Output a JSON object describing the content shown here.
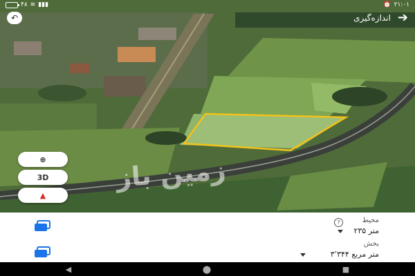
{
  "status_bar": {
    "time": "۲۱:۰۱",
    "battery": "۴۸"
  },
  "header": {
    "title": "اندازه‌گیری"
  },
  "map_controls": {
    "view_3d_label": "3D"
  },
  "watermark": "زمین باز",
  "measurement": {
    "perimeter": {
      "label": "محیط",
      "value": "۲۳۵ متر"
    },
    "area": {
      "label": "بخش",
      "value": "۳٬۳۴۴ متر مربع"
    }
  },
  "colors": {
    "outline": "#f3c21b",
    "sheet": "#ffffff",
    "copy_icon": "#1a73e8"
  },
  "icons": {
    "back": "arrow-right-icon",
    "location": "location-crosshair-icon",
    "compass": "compass-icon",
    "copy": "copy-icon",
    "info": "info-icon"
  }
}
